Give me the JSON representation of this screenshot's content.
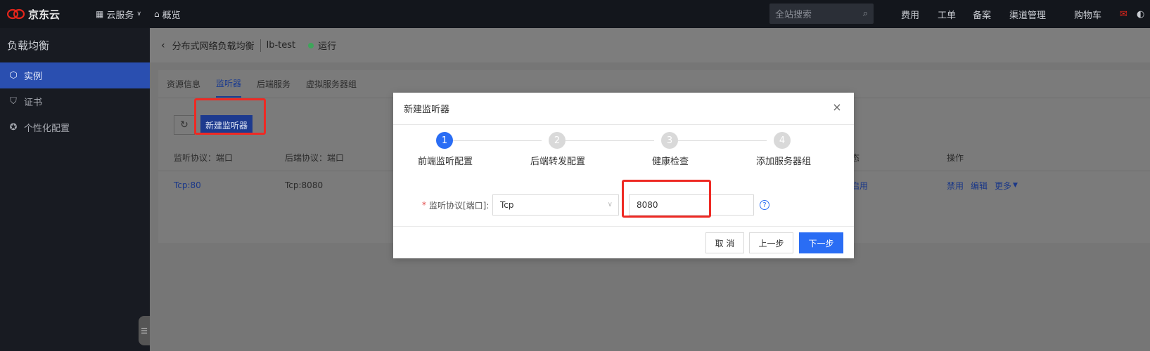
{
  "topbar": {
    "logo_text": "京东云",
    "nav": [
      "云服务",
      "概览"
    ],
    "search_placeholder": "全站搜索",
    "right_items": [
      "费用",
      "工单",
      "备案",
      "渠道管理",
      "购物车"
    ]
  },
  "sidebar": {
    "title": "负载均衡",
    "items": [
      {
        "label": "实例",
        "icon": "hexagon-icon"
      },
      {
        "label": "证书",
        "icon": "shield-icon"
      },
      {
        "label": "个性化配置",
        "icon": "star-circle-icon"
      }
    ]
  },
  "header": {
    "service": "分布式网络负载均衡",
    "instance": "lb-test",
    "status": "运行"
  },
  "tabs": [
    "资源信息",
    "监听器",
    "后端服务",
    "虚拟服务器组"
  ],
  "toolbar": {
    "new_listener": "新建监听器"
  },
  "table": {
    "headers": [
      "监听协议：端口",
      "后端协议：端口",
      "状态",
      "操作"
    ],
    "row": {
      "listener": "Tcp:80",
      "backend": "Tcp:8080",
      "status": "已启用",
      "actions": [
        "禁用",
        "编辑",
        "更多"
      ]
    }
  },
  "modal": {
    "title": "新建监听器",
    "steps": [
      {
        "num": "1",
        "label": "前端监听配置"
      },
      {
        "num": "2",
        "label": "后端转发配置"
      },
      {
        "num": "3",
        "label": "健康检查"
      },
      {
        "num": "4",
        "label": "添加服务器组"
      }
    ],
    "form": {
      "label": "监听协议[端口]:",
      "protocol": "Tcp",
      "port": "8080"
    },
    "buttons": {
      "cancel": "取 消",
      "prev": "上一步",
      "next": "下一步"
    }
  }
}
